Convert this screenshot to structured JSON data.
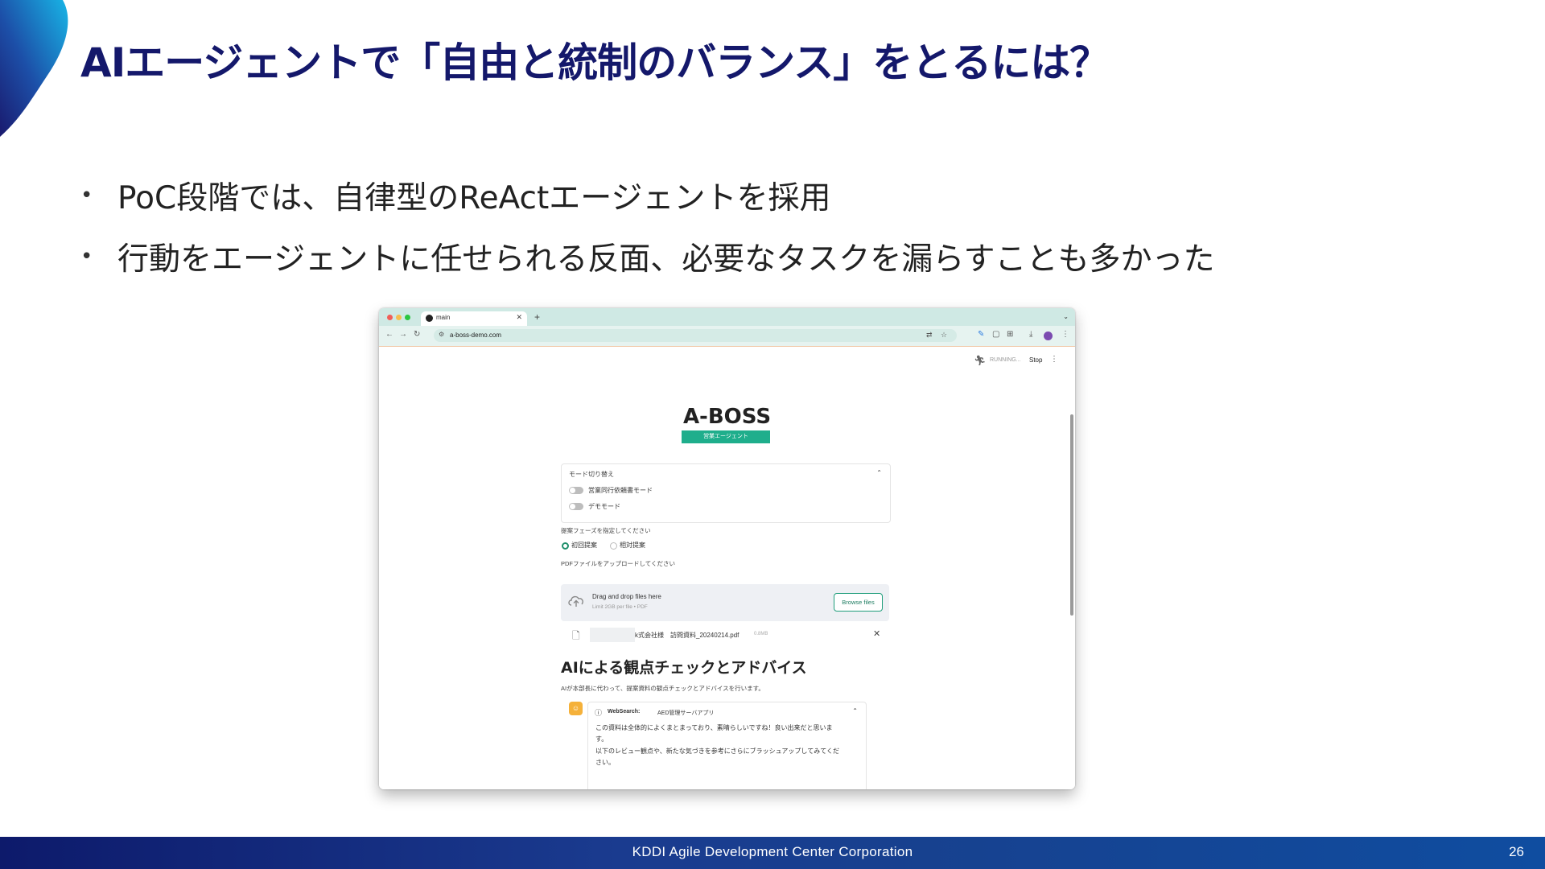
{
  "slide": {
    "title": "AIエージェントで「自由と統制のバランス」をとるには？",
    "bullets": [
      "PoC段階では、自律型のReActエージェントを採用",
      "行動をエージェントに任せられる反面、必要なタスクを漏らすことも多かった"
    ],
    "footer": "KDDI Agile Development Center Corporation",
    "page_number": "26"
  },
  "browser": {
    "tab_title": "main",
    "url": "a-boss-demo.com"
  },
  "app": {
    "status": "RUNNING...",
    "stop_label": "Stop",
    "title": "A-BOSS",
    "badge": "営業エージェント",
    "mode_panel": {
      "title": "モード切り替え",
      "toggles": [
        "営業同行依頼書モード",
        "デモモード"
      ]
    },
    "phase": {
      "label": "提案フェーズを指定してください",
      "options": [
        "初回提案",
        "相対提案"
      ],
      "selected": "初回提案"
    },
    "upload": {
      "label": "PDFファイルをアップロードしてください",
      "dropzone_title": "Drag and drop files here",
      "dropzone_limit": "Limit 2GB per file • PDF",
      "browse_label": "Browse files",
      "file_name": "k式会社様　訪問資料_20240214.pdf",
      "file_size": "0.8MB"
    },
    "advice": {
      "heading": "AIによる観点チェックとアドバイス",
      "description": "AIが本部長に代わって、提案資料の観点チェックとアドバイスを行います。",
      "tool_label": "WebSearch:",
      "tool_query": "AED管理サーバアプリ",
      "lines": [
        "この資料は全体的によくまとまっており、素晴らしいですね！良い出来だと思いま",
        "す。",
        "以下のレビュー観点や、新たな気づきを参考にさらにブラッシュアップしてみてくだ",
        "さい。"
      ]
    }
  },
  "icons": {
    "corner": "corner-swoosh",
    "run": "running-person-icon",
    "upload": "cloud-upload-icon",
    "file": "document-icon",
    "ai_avatar": "bot-avatar-icon"
  },
  "colors": {
    "title": "#14186b",
    "footer": "#17418f",
    "badge": "#1fae8c",
    "browse": "#1f9e7b",
    "ai_avatar": "#f5b13a"
  }
}
